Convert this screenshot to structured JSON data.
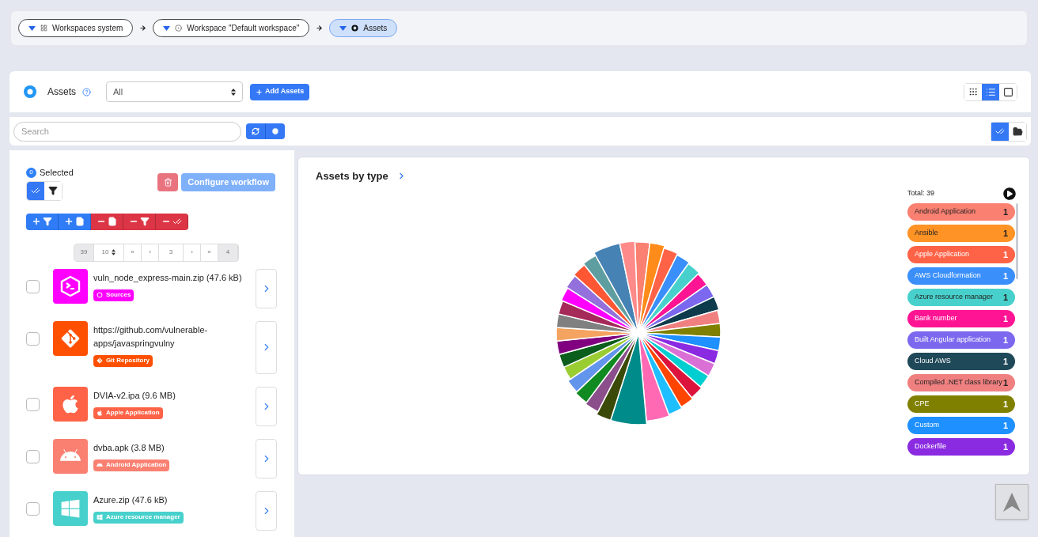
{
  "breadcrumbs": [
    {
      "label": "Workspaces system",
      "kind": "grid",
      "selected": false
    },
    {
      "label": "Workspace \"Default workspace\"",
      "kind": "target",
      "selected": false
    },
    {
      "label": "Assets",
      "kind": "dot",
      "selected": true
    }
  ],
  "header": {
    "title": "Assets",
    "filter": {
      "value": "All"
    },
    "add_button": "Add Assets",
    "views": [
      {
        "kind": "grid",
        "selected": false
      },
      {
        "kind": "list",
        "selected": true
      },
      {
        "kind": "single",
        "selected": false
      }
    ]
  },
  "search": {
    "placeholder": "Search",
    "modes": [
      {
        "kind": "check",
        "selected": true
      },
      {
        "kind": "folder",
        "selected": false
      }
    ]
  },
  "selection": {
    "count": "0",
    "label": "Selected",
    "toggles": [
      {
        "kind": "check",
        "selected": true
      },
      {
        "kind": "filter",
        "selected": false
      }
    ],
    "configure_button": {
      "label": "Configure workflow",
      "disabled": true
    }
  },
  "bulk_actions": [
    {
      "kind": "add-filter"
    },
    {
      "kind": "add-file"
    },
    {
      "kind": "remove-file"
    },
    {
      "kind": "remove-filter"
    },
    {
      "kind": "remove-check"
    }
  ],
  "pagination": [
    {
      "text": "39",
      "kind": "info"
    },
    {
      "text": "10",
      "kind": "size"
    },
    {
      "text": "«",
      "kind": "nav"
    },
    {
      "text": "‹",
      "kind": "nav"
    },
    {
      "text": "3",
      "kind": "page"
    },
    {
      "text": "›",
      "kind": "nav"
    },
    {
      "text": "»",
      "kind": "nav"
    },
    {
      "text": "4",
      "kind": "info"
    }
  ],
  "assets": [
    {
      "name": "vuln_node_express-main.zip (47.6 kB)",
      "tag": "Sources",
      "kind": "terminal",
      "color": "#ff00ff",
      "checked": false
    },
    {
      "name": "https://github.com/vulnerable-apps/javaspringvulny",
      "tag": "Git Repository",
      "kind": "git",
      "color": "#fe5000",
      "checked": false
    },
    {
      "name": "DVIA-v2.ipa (9.6 MB)",
      "tag": "Apple Application",
      "kind": "apple",
      "color": "#ff6347",
      "checked": false
    },
    {
      "name": "dvba.apk (3.8 MB)",
      "tag": "Android Application",
      "kind": "android",
      "color": "#fa8072",
      "checked": false
    },
    {
      "name": "Azure.zip (47.6 kB)",
      "tag": "Azure resource manager",
      "kind": "windows",
      "color": "#48d1cc",
      "checked": false
    }
  ],
  "chart_panel": {
    "title": "Assets by type",
    "total": "Total: 39",
    "legend": [
      {
        "label": "Android Application",
        "count": "1",
        "color": "#fa8072"
      },
      {
        "label": "Ansible",
        "count": "1",
        "color": "#ff9326"
      },
      {
        "label": "Apple Application",
        "count": "1",
        "color": "#ff6347"
      },
      {
        "label": "AWS Cloudformation",
        "count": "1",
        "color": "#3a8ffb"
      },
      {
        "label": "Azure resource manager",
        "count": "1",
        "color": "#48d1cc"
      },
      {
        "label": "Bank number",
        "count": "1",
        "color": "#ff1493"
      },
      {
        "label": "Built Angular application",
        "count": "1",
        "color": "#7b68ee"
      },
      {
        "label": "Cloud AWS",
        "count": "1",
        "color": "#1f4858"
      },
      {
        "label": "Compiled .NET class library",
        "count": "1",
        "color": "#f08080"
      },
      {
        "label": "CPE",
        "count": "1",
        "color": "#808000"
      },
      {
        "label": "Custom",
        "count": "1",
        "color": "#1e90ff"
      },
      {
        "label": "Dockerfile",
        "count": "1",
        "color": "#8a2be2"
      }
    ]
  }
}
